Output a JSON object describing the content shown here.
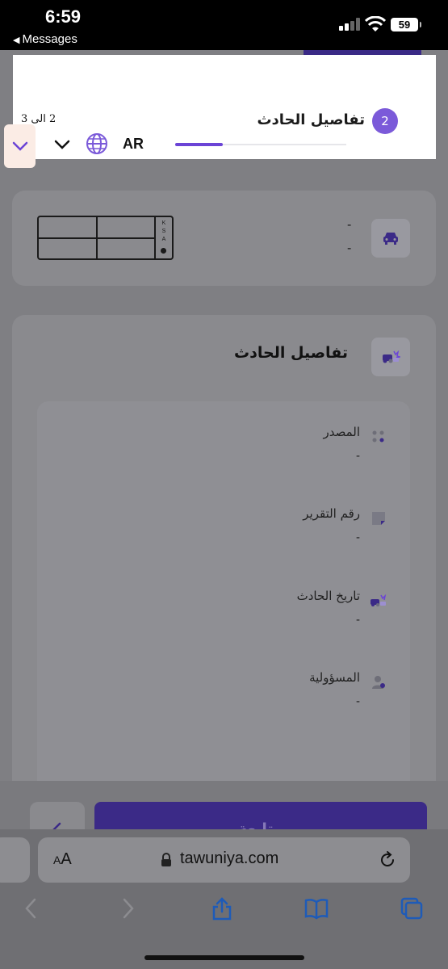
{
  "status_bar": {
    "time": "6:59",
    "back_app": "Messages",
    "battery": "59"
  },
  "stepper": {
    "step_number": "2",
    "step_title": "تفاصيل الحادث",
    "step_count": "2 الى 3",
    "progress": 0.28,
    "language": "AR"
  },
  "vehicle_card": {
    "plate_country": [
      "K",
      "S",
      "A"
    ],
    "line1": "-",
    "line2": "-"
  },
  "accident_section": {
    "title": "تفاصيل الحادث",
    "fields": [
      {
        "label": "المصدر",
        "value": "-",
        "icon": "source-dots-icon"
      },
      {
        "label": "رقم التقرير",
        "value": "-",
        "icon": "report-note-icon"
      },
      {
        "label": "تاريخ الحادث",
        "value": "-",
        "icon": "car-crash-icon"
      },
      {
        "label": "المسؤولية",
        "value": "-",
        "icon": "person-icon"
      }
    ]
  },
  "footer": {
    "continue_label": "متابعة"
  },
  "browser": {
    "aa_label": "AA",
    "url": "tawuniya.com"
  },
  "colors": {
    "accent": "#6b44d6",
    "primary_button": "#3b2a87",
    "overlay": "#7f7f83"
  }
}
